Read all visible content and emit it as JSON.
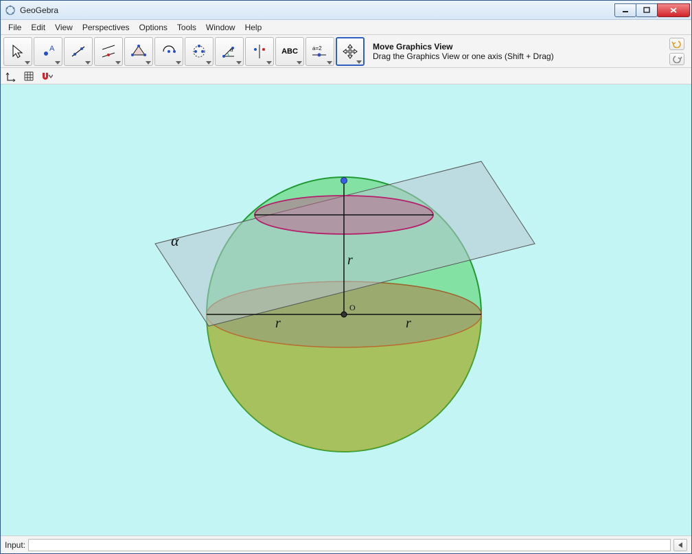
{
  "window": {
    "title": "GeoGebra"
  },
  "menu": {
    "items": [
      "File",
      "Edit",
      "View",
      "Perspectives",
      "Options",
      "Tools",
      "Window",
      "Help"
    ]
  },
  "toolbar": {
    "tools": [
      {
        "name": "move",
        "selected": false
      },
      {
        "name": "point",
        "selected": false
      },
      {
        "name": "line",
        "selected": false
      },
      {
        "name": "perpendicular",
        "selected": false
      },
      {
        "name": "polygon",
        "selected": false
      },
      {
        "name": "circle",
        "selected": false
      },
      {
        "name": "ellipse",
        "selected": false
      },
      {
        "name": "angle",
        "selected": false
      },
      {
        "name": "reflect",
        "selected": false
      },
      {
        "name": "text",
        "selected": false
      },
      {
        "name": "slider",
        "selected": false
      },
      {
        "name": "move-view",
        "selected": true
      }
    ],
    "text_label": "ABC",
    "slider_label": "a=2",
    "active": {
      "title": "Move Graphics View",
      "hint": "Drag the Graphics View or one axis (Shift + Drag)"
    }
  },
  "graphics_toolbar": {
    "magnet_color": "#d2232a"
  },
  "diagram": {
    "alpha": "α",
    "r_top": "r",
    "r_left": "r",
    "r_right": "r",
    "origin": "O"
  },
  "inputbar": {
    "label": "Input:",
    "value": "",
    "placeholder": ""
  }
}
